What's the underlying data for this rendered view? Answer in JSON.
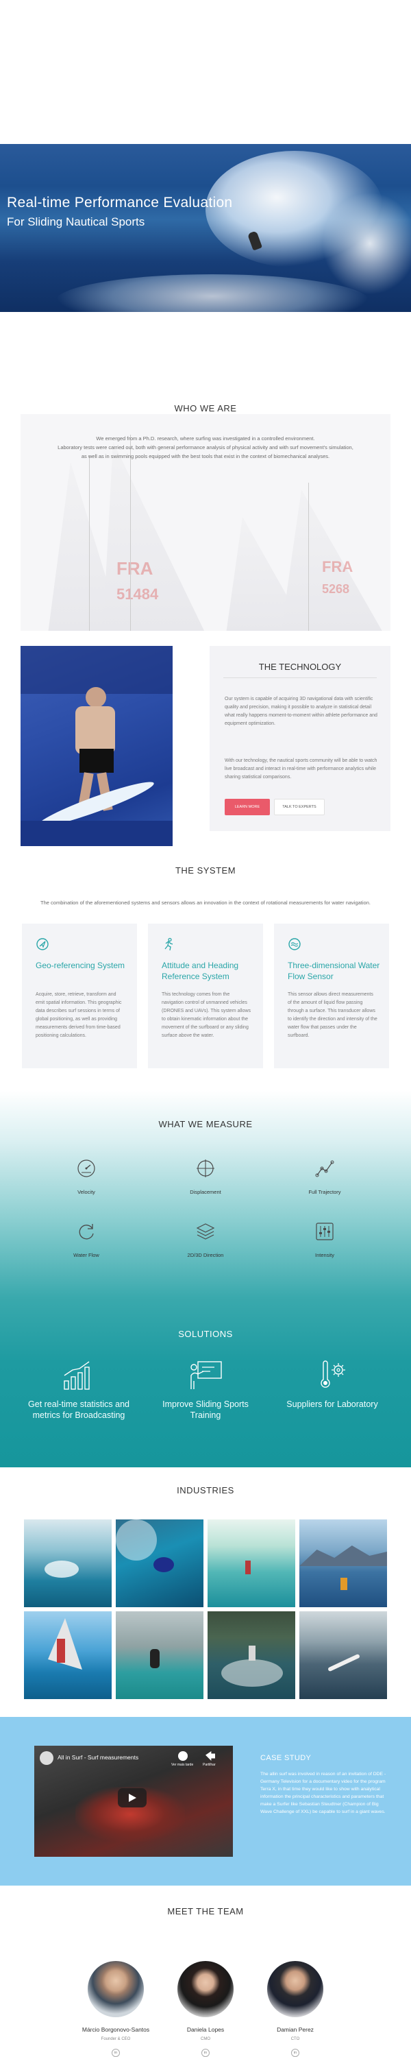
{
  "hero": {
    "title": "Real-time Performance Evaluation",
    "subtitle": "For Sliding Nautical Sports"
  },
  "who_we_are": {
    "title": "WHO WE ARE",
    "line1": "We emerged from a Ph.D. research, where surfing was investigated in a controlled environment.",
    "line2": "Laboratory tests were carried out, both with general performance analysis of physical activity and with surf movement's simulation, as well as in swimming pools equipped with the best tools that exist in the context of biomechanical analyses.",
    "sail_texts": [
      "FRA",
      "51484",
      "FRA",
      "5268"
    ]
  },
  "technology": {
    "title": "THE TECHNOLOGY",
    "para1": "Our system is capable of acquiring 3D navigational data with scientific quality and precision, making it possible to analyze in statistical detail what really happens moment-to-moment within athlete performance and equipment optimization.",
    "para2": "With our technology, the nautical sports community will be able to watch live broadcast and interact in real-time with performance analytics while sharing statistical comparisons.",
    "learn_more": "LEARN MORE",
    "talk_experts": "TALK TO EXPERTS"
  },
  "system": {
    "title": "THE SYSTEM",
    "subtitle": "The combination of the aforementioned systems and sensors allows an innovation in the context of rotational measurements for water navigation.",
    "cards": [
      {
        "icon": "navigation-icon",
        "title": "Geo-referencing System",
        "text": "Acquire, store, retrieve, transform and emit spatial information. This geographic data describes surf sessions in terms of global positioning, as well as providing measurements derived from time-based positioning calculations."
      },
      {
        "icon": "running-person-icon",
        "title": "Attitude and Heading Reference System",
        "text": "This technology comes from the navigation control of unmanned vehicles (DRONES and UAVs). This system allows to obtain kinematic information about the movement of the surfboard or any sliding surface above the water."
      },
      {
        "icon": "water-flow-icon",
        "title": "Three-dimensional Water Flow Sensor",
        "text": "This sensor allows direct measurements of the amount of liquid flow passing through a surface. This transducer allows to identify the direction and intensity of the water flow that passes under the surfboard."
      }
    ]
  },
  "measure": {
    "title": "WHAT WE MEASURE",
    "items": [
      {
        "label": "Velocity",
        "icon": "speedometer-icon"
      },
      {
        "label": "Displacement",
        "icon": "crosshair-icon"
      },
      {
        "label": "Full Trajectory",
        "icon": "trajectory-icon"
      },
      {
        "label": "Water Flow",
        "icon": "refresh-flow-icon"
      },
      {
        "label": "2D/3D Direction",
        "icon": "layers-icon"
      },
      {
        "label": "Intensity",
        "icon": "sliders-icon"
      }
    ]
  },
  "solutions": {
    "title": "SOLUTIONS",
    "items": [
      {
        "label": "Get real-time statistics and metrics for Broadcasting",
        "icon": "bar-chart-icon"
      },
      {
        "label": "Improve Sliding Sports Training",
        "icon": "presentation-board-icon"
      },
      {
        "label": "Suppliers for Laboratory",
        "icon": "thermometer-gear-icon"
      }
    ]
  },
  "industries": {
    "title": "INDUSTRIES"
  },
  "case_study": {
    "video_title": "All in Surf - Surf measurements",
    "watch_later": "Ver mais tarde",
    "share": "Partilhar",
    "title": "CASE STUDY",
    "text": "The allin surf was involved in reason of an invitation of DDE - Germany Television for a documentary video for the program Terra X, in that time they would like to show with analytical information the principal characteristics and parameters that make a Surfer like Sebastian Steudtner (Champion of Big Wave Challenge of XXL) be capable to surf in a giant waves."
  },
  "team": {
    "title": "MEET THE TEAM",
    "members": [
      {
        "name": "Márcio Borgonovo-Santos",
        "role": "Founder & CEO"
      },
      {
        "name": "Daniela Lopes",
        "role": "CMO"
      },
      {
        "name": "Damian Perez",
        "role": "CTO"
      }
    ]
  },
  "colors": {
    "accent_teal": "#2aa6a8",
    "button_red": "#ea5a6a",
    "case_blue": "#8dcdf0"
  }
}
